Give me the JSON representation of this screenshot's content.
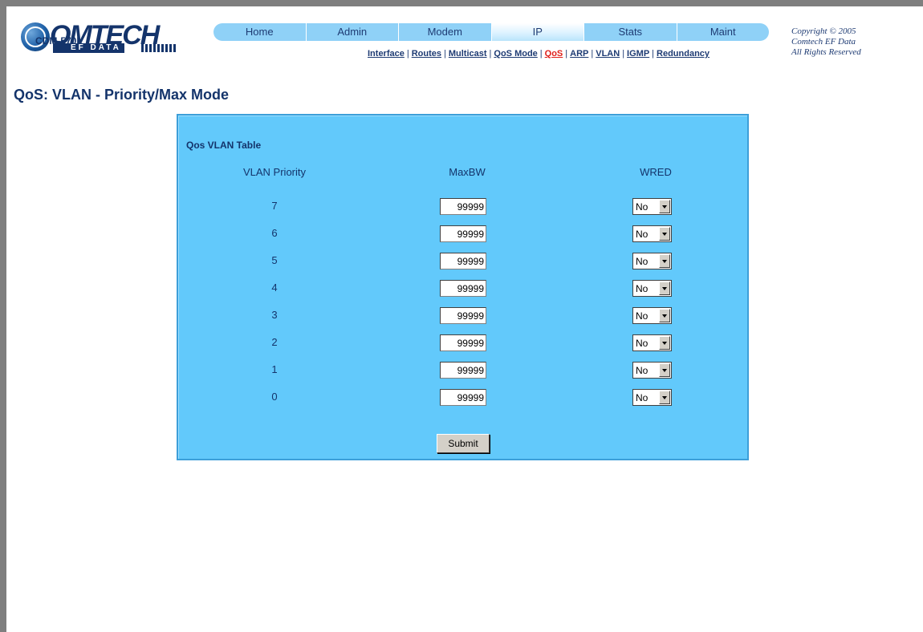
{
  "brand": {
    "logo_text": "OMTECH",
    "logo_sub": "EF DATA",
    "model": "CDM-570L"
  },
  "nav": {
    "items": [
      {
        "label": "Home"
      },
      {
        "label": "Admin"
      },
      {
        "label": "Modem"
      },
      {
        "label": "IP",
        "active": true
      },
      {
        "label": "Stats"
      },
      {
        "label": "Maint"
      }
    ]
  },
  "subnav": {
    "items": [
      {
        "label": "Interface"
      },
      {
        "label": "Routes"
      },
      {
        "label": "Multicast"
      },
      {
        "label": "QoS Mode"
      },
      {
        "label": "QoS",
        "active": true
      },
      {
        "label": "ARP"
      },
      {
        "label": "VLAN"
      },
      {
        "label": "IGMP"
      },
      {
        "label": "Redundancy"
      }
    ]
  },
  "copyright": {
    "line1": "Copyright © 2005",
    "line2": "Comtech EF Data",
    "line3": "All Rights Reserved"
  },
  "page": {
    "title": "QoS: VLAN - Priority/Max Mode"
  },
  "table": {
    "title": "Qos VLAN Table",
    "headers": {
      "priority": "VLAN Priority",
      "maxbw": "MaxBW",
      "wred": "WRED"
    },
    "rows": [
      {
        "priority": "7",
        "maxbw": "99999",
        "wred": "No"
      },
      {
        "priority": "6",
        "maxbw": "99999",
        "wred": "No"
      },
      {
        "priority": "5",
        "maxbw": "99999",
        "wred": "No"
      },
      {
        "priority": "4",
        "maxbw": "99999",
        "wred": "No"
      },
      {
        "priority": "3",
        "maxbw": "99999",
        "wred": "No"
      },
      {
        "priority": "2",
        "maxbw": "99999",
        "wred": "No"
      },
      {
        "priority": "1",
        "maxbw": "99999",
        "wred": "No"
      },
      {
        "priority": "0",
        "maxbw": "99999",
        "wred": "No"
      }
    ],
    "submit_label": "Submit"
  }
}
